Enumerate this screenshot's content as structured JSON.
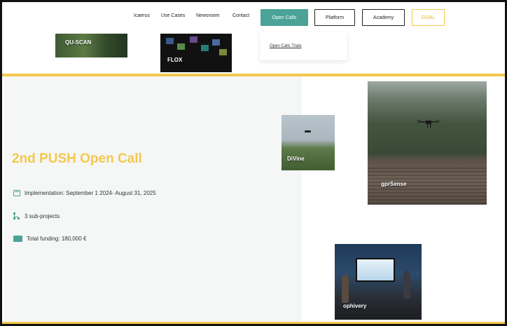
{
  "nav": {
    "links": [
      "Icaerus",
      "Use Cases",
      "Newsroom",
      "Contact"
    ],
    "buttons": {
      "open_calls": "Open Calls",
      "platform": "Platform",
      "academy": "Academy",
      "goal": "GOAL"
    },
    "dropdown": {
      "item": "Open Calls Trials"
    }
  },
  "tiles": {
    "qu_scan": "QU-SCAN",
    "flox": "FLOX",
    "divine": "DiVine",
    "gprsense": "gprSense",
    "ophivery": "ophivery"
  },
  "hero": {
    "title": "2nd PUSH Open Call",
    "implementation": "Implementation: September 1 2024- August 31, 2025",
    "subprojects": "3 sub-projects",
    "funding": "Total funding: 180,000 €"
  },
  "colors": {
    "accent_yellow": "#f2c94c",
    "accent_teal": "#4ba398"
  }
}
